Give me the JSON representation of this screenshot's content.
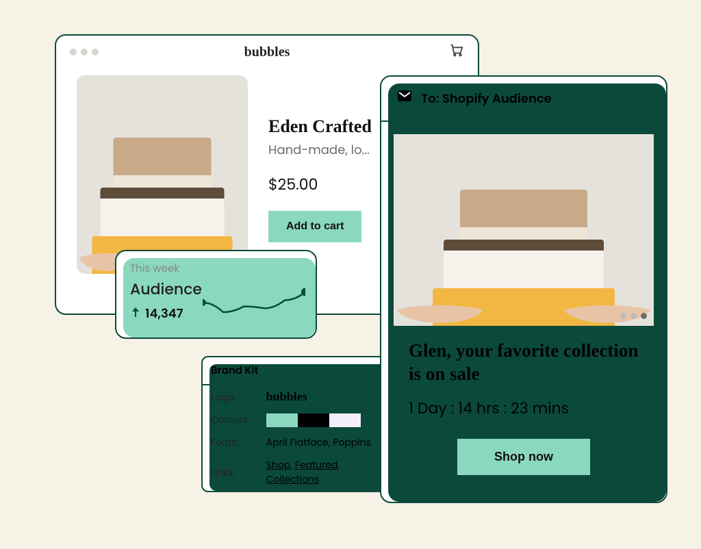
{
  "browser": {
    "brand": "bubbles",
    "product": {
      "title": "Eden Crafted",
      "subtitle": "Hand-made, lo...",
      "price": "$25.00",
      "cta": "Add to cart"
    }
  },
  "audience": {
    "subheading": "This week",
    "heading": "Audience",
    "value": "14,347"
  },
  "brand_kit": {
    "title": "Brand Kit",
    "rows": {
      "logo_key": "Logo:",
      "logo_val": "bubbles",
      "colours_key": "Colours:",
      "swatches": [
        "#8ad8bf",
        "#000000",
        "#f2effa"
      ],
      "fonts_key": "Fonts:",
      "fonts_val": "April Flatface, Poppins",
      "links_key": "Links:",
      "links": [
        "Shop",
        "Featured",
        "Collections"
      ]
    }
  },
  "email": {
    "to_label": "To:",
    "to_value": "Shopify Audience",
    "headline": "Glen, your favorite collection is on sale",
    "timer": "1 Day : 14 hrs : 23 mins",
    "cta": "Shop now"
  },
  "chart_data": {
    "type": "line",
    "title": "Audience (This week)",
    "x": [
      0,
      1,
      2,
      3,
      4,
      5
    ],
    "values": [
      50,
      30,
      42,
      38,
      55,
      72
    ],
    "ylim": [
      0,
      100
    ]
  }
}
